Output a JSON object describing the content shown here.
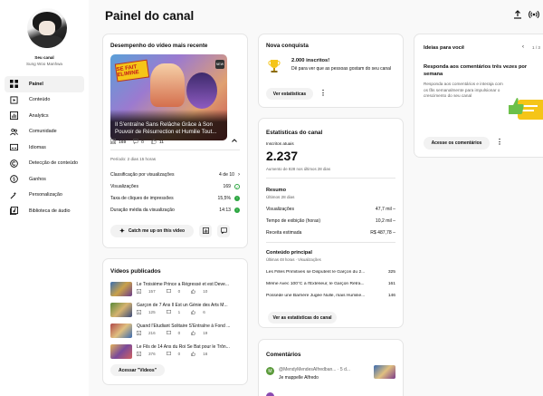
{
  "header": {
    "title": "Painel do canal",
    "upload_icon": "upload-icon",
    "live_icon": "live-icon"
  },
  "sidebar": {
    "channel_label": "Seu canal",
    "channel_name": "Sung Woo Manhwa",
    "items": [
      {
        "label": "Painel",
        "icon": "dashboard-icon",
        "active": true
      },
      {
        "label": "Conteúdo",
        "icon": "content-icon"
      },
      {
        "label": "Analytics",
        "icon": "analytics-icon"
      },
      {
        "label": "Comunidade",
        "icon": "community-icon"
      },
      {
        "label": "Idiomas",
        "icon": "subtitles-icon"
      },
      {
        "label": "Detecção de conteúdo",
        "icon": "copyright-icon"
      },
      {
        "label": "Ganhos",
        "icon": "earn-icon"
      },
      {
        "label": "Personalização",
        "icon": "customization-icon"
      },
      {
        "label": "Biblioteca de áudio",
        "icon": "audio-library-icon"
      }
    ]
  },
  "latest_video": {
    "title": "Desempenho do vídeo mais recente",
    "thumb_logo": "SE FAIT ELIMINE",
    "thumb_badge": "NEW",
    "caption": "Il S'entraîne Sans Relâche Grâce à Son Pouvoir de Résurrection et Humilie Tout...",
    "views": "169",
    "comments": "0",
    "likes": "11",
    "period": "Período: 2 dias 15 horas",
    "rows": [
      {
        "label": "Classificação por visualizações",
        "value": "4 de 10"
      },
      {
        "label": "Visualizações",
        "value": "169"
      },
      {
        "label": "Taxa de cliques de impressões",
        "value": "15,5%"
      },
      {
        "label": "Duração média da visualização",
        "value": "14:13"
      }
    ],
    "catch_button": "Catch me up on this video"
  },
  "published": {
    "title": "Vídeos publicados",
    "videos": [
      {
        "title": "Le Troisième Prince a Régressé et est Deve...",
        "views": "157",
        "comments": "0",
        "likes": "10"
      },
      {
        "title": "Garçon de 7 Ans Il Est un Génie des Arts M...",
        "views": "125",
        "comments": "1",
        "likes": "6"
      },
      {
        "title": "Quand l'Étudiant Solitaire S'Entraîne à Fond ...",
        "views": "216",
        "comments": "0",
        "likes": "19"
      },
      {
        "title": "Le Fils de 14 Ans du Roi Se Bat pour le Trôn...",
        "views": "376",
        "comments": "0",
        "likes": "16"
      }
    ],
    "button": "Acessar \"Vídeos\""
  },
  "achievement": {
    "title": "Nova conquista",
    "headline": "2.000 inscritos!",
    "text": "Dê para ver que as pessoas gostam do seu canal",
    "button": "Ver estatísticas"
  },
  "channel_stats": {
    "title": "Estatísticas do canal",
    "subs_label": "Inscritos atuais",
    "subs_value": "2.237",
    "subs_change": "Aumento de 828 nos últimos 28 dias",
    "summary_title": "Resumo",
    "summary_period": "Últimos 28 dias",
    "summary_rows": [
      {
        "label": "Visualizações",
        "value": "47,7 mil"
      },
      {
        "label": "Tempo de exibição (horas)",
        "value": "10,2 mil"
      },
      {
        "label": "Receita estimada",
        "value": "R$ 487,78"
      }
    ],
    "top_title": "Conteúdo principal",
    "top_period": "Últimas 48 horas · Visualizações",
    "top_rows": [
      {
        "title": "Les Filles Primitives se Disputent le Garçon du 2...",
        "value": "325"
      },
      {
        "title": "Même Avec 100°C à l'Extérieur, le Garçon Rétra...",
        "value": "161"
      },
      {
        "title": "Possède une Barrière Jugée Nulle, mais Humilie...",
        "value": "146"
      }
    ],
    "button": "Ver as estatísticas do canal"
  },
  "comments": {
    "title": "Comentários",
    "author": "@MendyMendesAlfredban...",
    "time": "· 5 d...",
    "text": "Je mappelle Alfredo"
  },
  "ideas": {
    "title": "Ideias para você",
    "pager": "1 / 3",
    "headline": "Responda aos comentários três vezes por semana",
    "text": "Responda aos comentários e interaja com os fãs semanalmente para impulsionar o crescimento do seu canal",
    "button": "Acesse os comentários"
  },
  "colors": {
    "accent": "#065fd4",
    "green": "#2ba640",
    "gold": "#f5c518"
  }
}
